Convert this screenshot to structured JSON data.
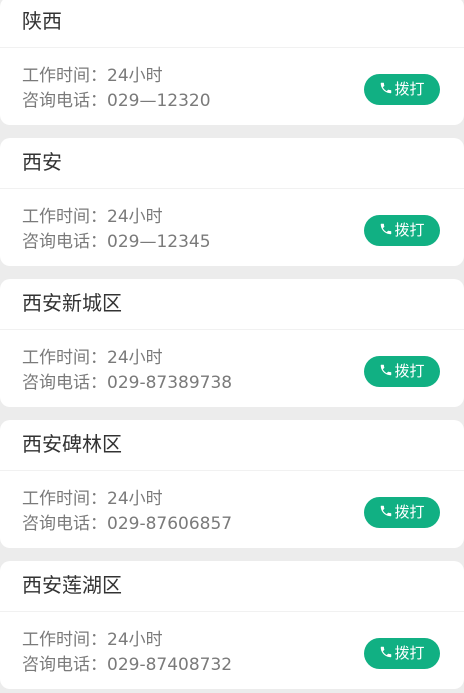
{
  "offices": [
    {
      "name": "陕西",
      "hours_label": "工作时间：",
      "hours": "24小时",
      "phone_label": "咨询电话：",
      "phone": "029—12320",
      "call_label": "拨打"
    },
    {
      "name": "西安",
      "hours_label": "工作时间：",
      "hours": "24小时",
      "phone_label": "咨询电话：",
      "phone": "029—12345",
      "call_label": "拨打"
    },
    {
      "name": "西安新城区",
      "hours_label": "工作时间：",
      "hours": "24小时",
      "phone_label": "咨询电话：",
      "phone": "029-87389738",
      "call_label": "拨打"
    },
    {
      "name": "西安碑林区",
      "hours_label": "工作时间：",
      "hours": "24小时",
      "phone_label": "咨询电话：",
      "phone": "029-87606857",
      "call_label": "拨打"
    },
    {
      "name": "西安莲湖区",
      "hours_label": "工作时间：",
      "hours": "24小时",
      "phone_label": "咨询电话：",
      "phone": "029-87408732",
      "call_label": "拨打"
    }
  ],
  "colors": {
    "accent": "#11b083",
    "page_background": "#ececec",
    "card_background": "#ffffff",
    "title_text": "#333333",
    "info_text": "#7a7a7a"
  },
  "icons": {
    "call": "phone-icon"
  }
}
